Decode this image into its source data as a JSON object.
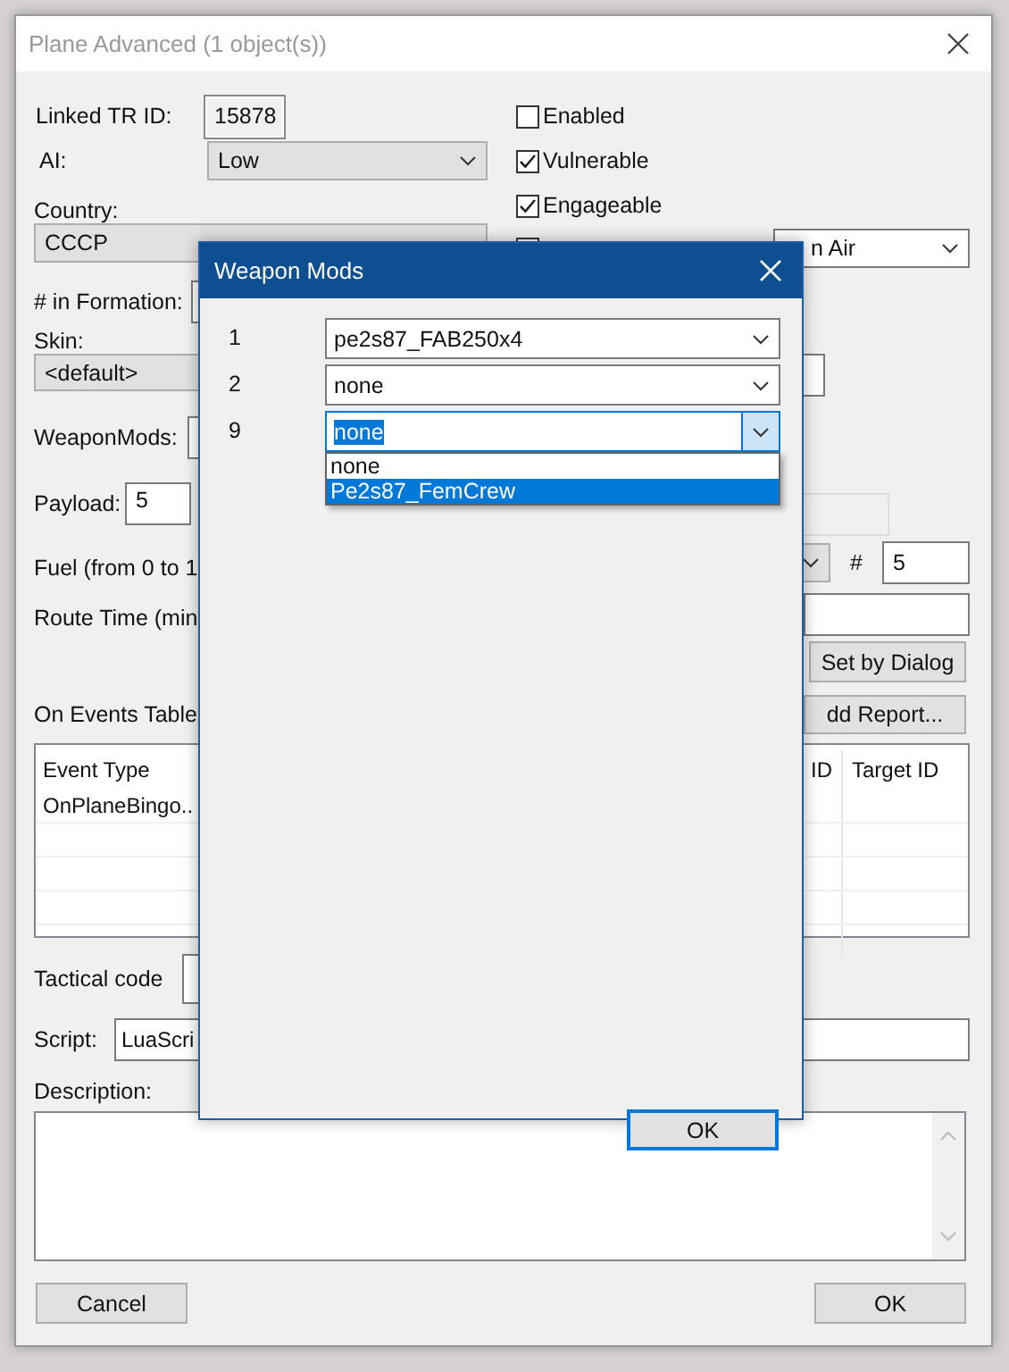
{
  "window": {
    "title": "Plane Advanced (1 object(s))"
  },
  "linked_tr_id": {
    "label": "Linked TR ID:",
    "value": "15878"
  },
  "ai": {
    "label": "AI:",
    "value": "Low"
  },
  "country": {
    "label": "Country:",
    "value": "CCCP"
  },
  "in_formation": {
    "label": "# in Formation:"
  },
  "skin": {
    "label": "Skin:",
    "value": "<default>"
  },
  "weapon_mods": {
    "label": "WeaponMods:"
  },
  "payload": {
    "label": "Payload:",
    "value": "5"
  },
  "fuel": {
    "label": "Fuel (from 0 to 1"
  },
  "route_time": {
    "label": "Route Time (min"
  },
  "checkboxes": [
    {
      "label": "Enabled",
      "checked": false
    },
    {
      "label": "Vulnerable",
      "checked": true
    },
    {
      "label": "Engageable",
      "checked": true
    }
  ],
  "start_state": {
    "value": "n Air"
  },
  "count": {
    "label": "#",
    "value": "5"
  },
  "set_by_dialog": "Set by Dialog",
  "events": {
    "title": "On Events Table",
    "add_report": "dd Report...",
    "columns": [
      "Event Type",
      "ID",
      "Target ID"
    ],
    "rows": [
      {
        "event_type": "OnPlaneBingo.."
      }
    ]
  },
  "tactical_code": {
    "label": "Tactical code"
  },
  "script": {
    "label": "Script:",
    "value": "LuaScri"
  },
  "description": {
    "label": "Description:"
  },
  "buttons": {
    "cancel": "Cancel",
    "ok": "OK"
  },
  "modal": {
    "title": "Weapon Mods",
    "rows": [
      {
        "index": "1",
        "value": "pe2s87_FAB250x4",
        "focused": false
      },
      {
        "index": "2",
        "value": "none",
        "focused": false
      },
      {
        "index": "9",
        "value": "none",
        "focused": true
      }
    ],
    "dropdown": [
      {
        "label": "none",
        "selected": false
      },
      {
        "label": "Pe2s87_FemCrew",
        "selected": true
      }
    ],
    "ok": "OK"
  }
}
